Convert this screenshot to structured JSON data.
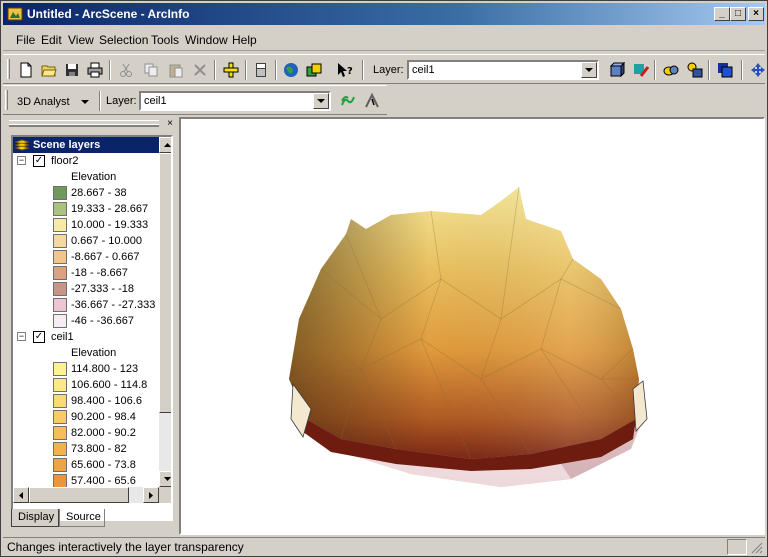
{
  "window": {
    "title": "Untitled - ArcScene - ArcInfo",
    "minimize": "_",
    "maximize": "□",
    "close": "×"
  },
  "menu": [
    "File",
    "Edit",
    "View",
    "Selection",
    "Tools",
    "Window",
    "Help"
  ],
  "standard_toolbar": {
    "layer_label": "Layer:",
    "layer_value": "ceil1"
  },
  "analyst_toolbar": {
    "menu_label": "3D Analyst",
    "layer_label": "Layer:",
    "layer_value": "ceil1"
  },
  "toc": {
    "title": "Scene layers",
    "layers": [
      {
        "name": "floor2",
        "checked": true,
        "legend_title": "Elevation",
        "classes": [
          {
            "label": "28.667 - 38",
            "color": "#6f9a5c"
          },
          {
            "label": "19.333 - 28.667",
            "color": "#a9c37f"
          },
          {
            "label": "10.000 - 19.333",
            "color": "#f6eaa8"
          },
          {
            "label": "0.667 - 10.000",
            "color": "#f3d9a0"
          },
          {
            "label": "-8.667 - 0.667",
            "color": "#f2c48e"
          },
          {
            "label": "-18 - -8.667",
            "color": "#dba281"
          },
          {
            "label": "-27.333 - -18",
            "color": "#c99488"
          },
          {
            "label": "-36.667 - -27.333",
            "color": "#ecc5d2"
          },
          {
            "label": "-46 - -36.667",
            "color": "#f8ecf4"
          }
        ]
      },
      {
        "name": "ceil1",
        "checked": true,
        "legend_title": "Elevation",
        "classes": [
          {
            "label": "114.800 - 123",
            "color": "#fbf390"
          },
          {
            "label": "106.600 - 114.8",
            "color": "#fbe985"
          },
          {
            "label": "98.400 - 106.6",
            "color": "#fadb72"
          },
          {
            "label": "90.200 - 98.4",
            "color": "#f8cc61"
          },
          {
            "label": "82.000 - 90.2",
            "color": "#f6bf56"
          },
          {
            "label": "73.800 - 82",
            "color": "#f4b24b"
          },
          {
            "label": "65.600 - 73.8",
            "color": "#f0a343"
          },
          {
            "label": "57.400 - 65.6",
            "color": "#ed9539"
          }
        ]
      }
    ],
    "tabs": [
      "Display",
      "Source"
    ]
  },
  "status": {
    "message": "Changes interactively the layer transparency"
  }
}
